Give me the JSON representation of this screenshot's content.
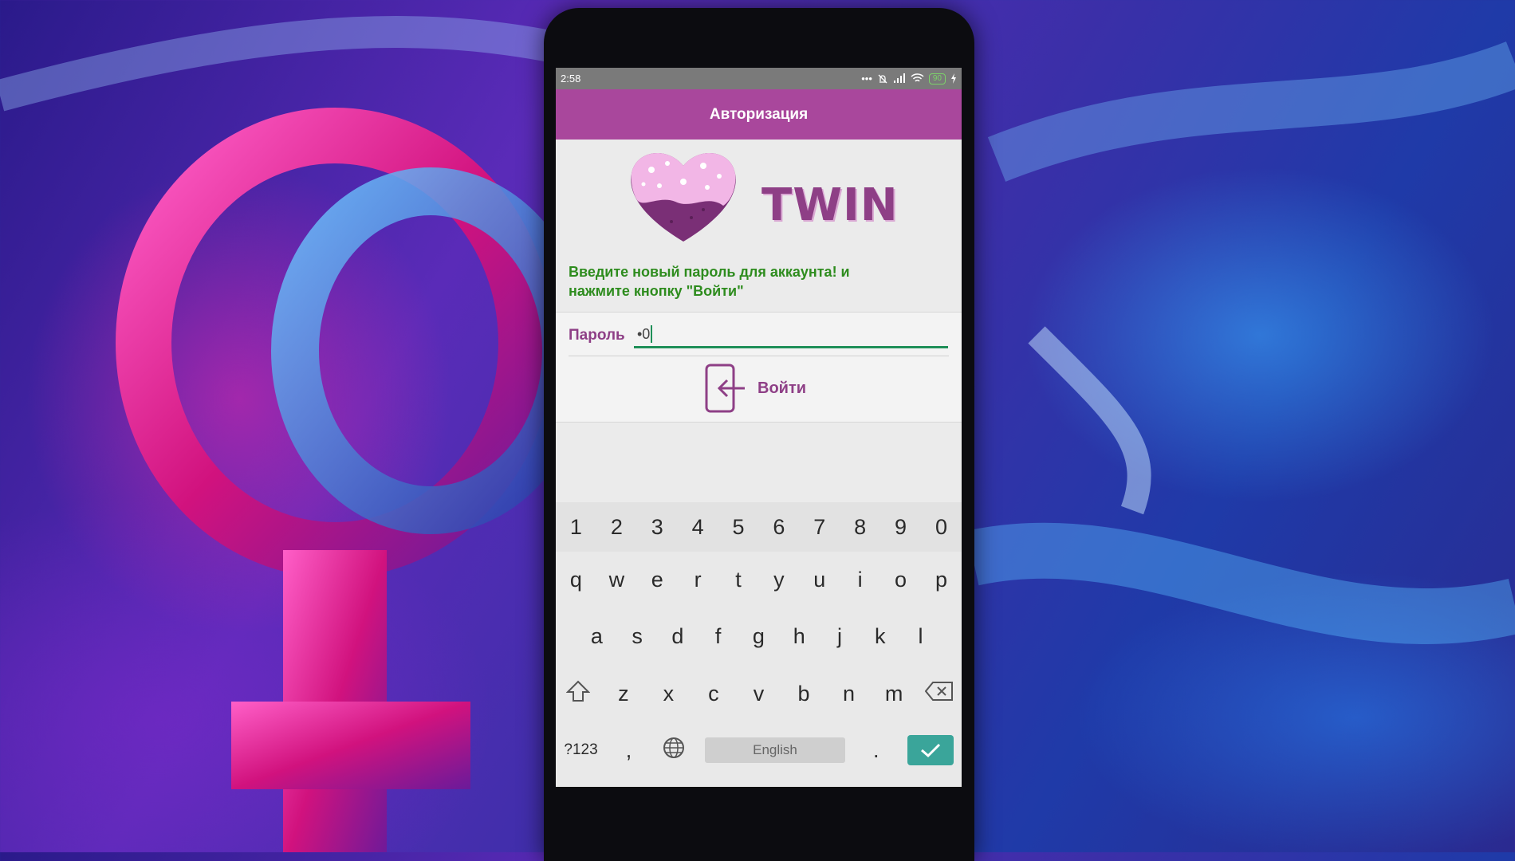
{
  "status_bar": {
    "time": "2:58",
    "battery": "90"
  },
  "app_bar": {
    "title": "Авторизация"
  },
  "logo": {
    "text": "TWIN"
  },
  "instruction": {
    "line1": "Введите новый пароль для аккаунта! и",
    "line2": "нажмите кнопку \"Войти\""
  },
  "password": {
    "label": "Пароль",
    "value": "•0"
  },
  "login_button": {
    "label": "Войти"
  },
  "keyboard": {
    "numbers": [
      "1",
      "2",
      "3",
      "4",
      "5",
      "6",
      "7",
      "8",
      "9",
      "0"
    ],
    "row1": [
      "q",
      "w",
      "e",
      "r",
      "t",
      "y",
      "u",
      "i",
      "o",
      "p"
    ],
    "row2": [
      "a",
      "s",
      "d",
      "f",
      "g",
      "h",
      "j",
      "k",
      "l"
    ],
    "row3": [
      "z",
      "x",
      "c",
      "v",
      "b",
      "n",
      "m"
    ],
    "symbols_key": "?123",
    "comma_key": ",",
    "period_key": ".",
    "space_label": "English"
  },
  "colors": {
    "app_bar": "#a9479c",
    "brand_purple": "#8e3f86",
    "instruction_green": "#2e8c1e",
    "field_underline": "#1f8f58",
    "enter_key": "#3aa59a"
  },
  "icons": [
    "notification-off-icon",
    "signal-icon",
    "wifi-icon",
    "battery-icon",
    "charging-icon",
    "login-icon",
    "shift-icon",
    "backspace-icon",
    "globe-icon",
    "check-icon"
  ]
}
